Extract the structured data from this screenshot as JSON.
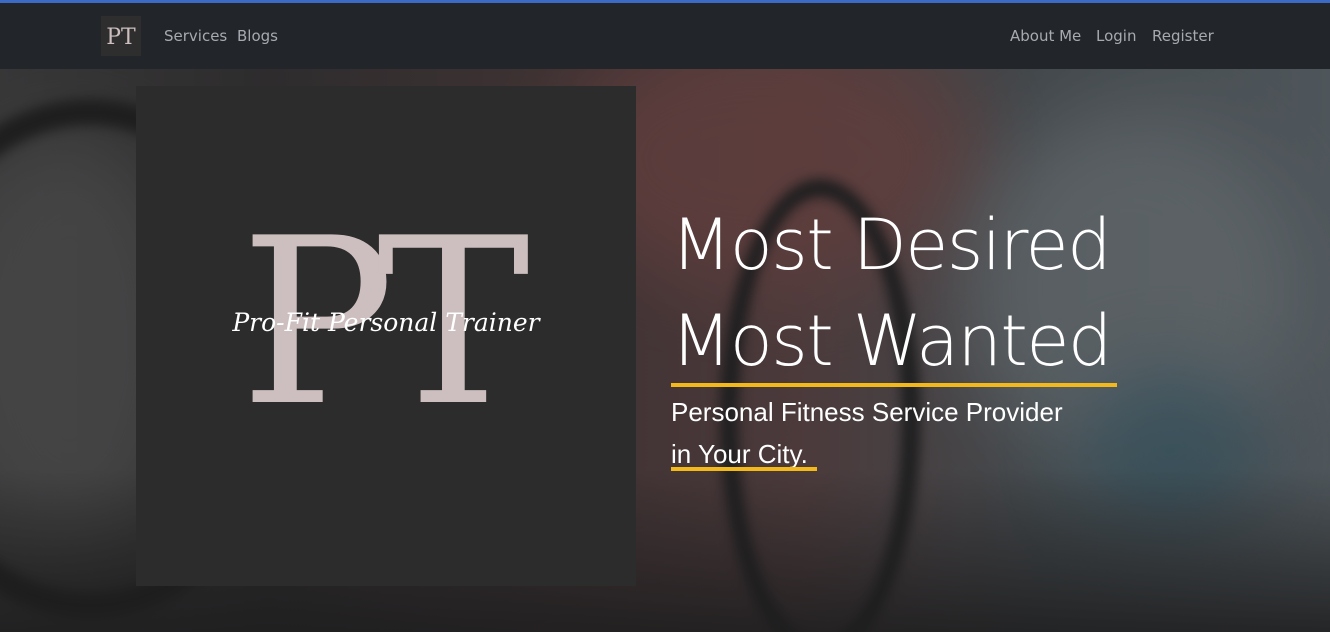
{
  "navbar": {
    "brand_text": "PT",
    "left_links": [
      "Services",
      "Blogs"
    ],
    "right_links": [
      "About Me",
      "Login",
      "Register"
    ]
  },
  "hero": {
    "logo_monogram": "PT",
    "logo_script": "Pro-Fit Personal Trainer",
    "headline_line1": "Most Desired",
    "headline_line2": "Most Wanted",
    "subline_line1": "Personal Fitness Service Provider",
    "subline_line2": "in Your City."
  },
  "colors": {
    "accent": "#f3b81a",
    "navbar": "#222529",
    "logo_bg": "#2c2c2c",
    "logo_fg": "#cdbfbf"
  }
}
